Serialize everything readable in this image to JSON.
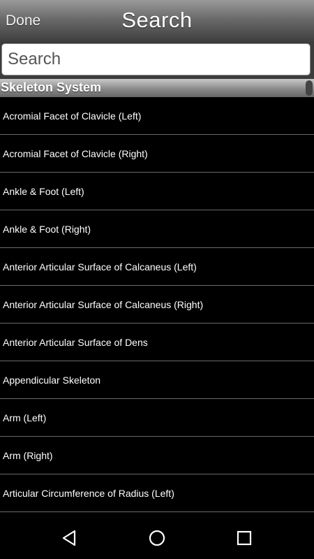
{
  "header": {
    "done_label": "Done",
    "title": "Search"
  },
  "search": {
    "placeholder": "Search",
    "value": ""
  },
  "section": {
    "label": "Skeleton System"
  },
  "items": [
    "Acromial Facet of Clavicle (Left)",
    "Acromial Facet of Clavicle (Right)",
    "Ankle & Foot (Left)",
    "Ankle & Foot (Right)",
    "Anterior Articular Surface of Calcaneus (Left)",
    "Anterior Articular Surface of Calcaneus (Right)",
    "Anterior Articular Surface of Dens",
    "Appendicular Skeleton",
    "Arm (Left)",
    "Arm (Right)",
    "Articular Circumference of Radius (Left)"
  ],
  "navbar": {
    "icons": [
      "back-icon",
      "home-icon",
      "recent-apps-icon"
    ]
  }
}
